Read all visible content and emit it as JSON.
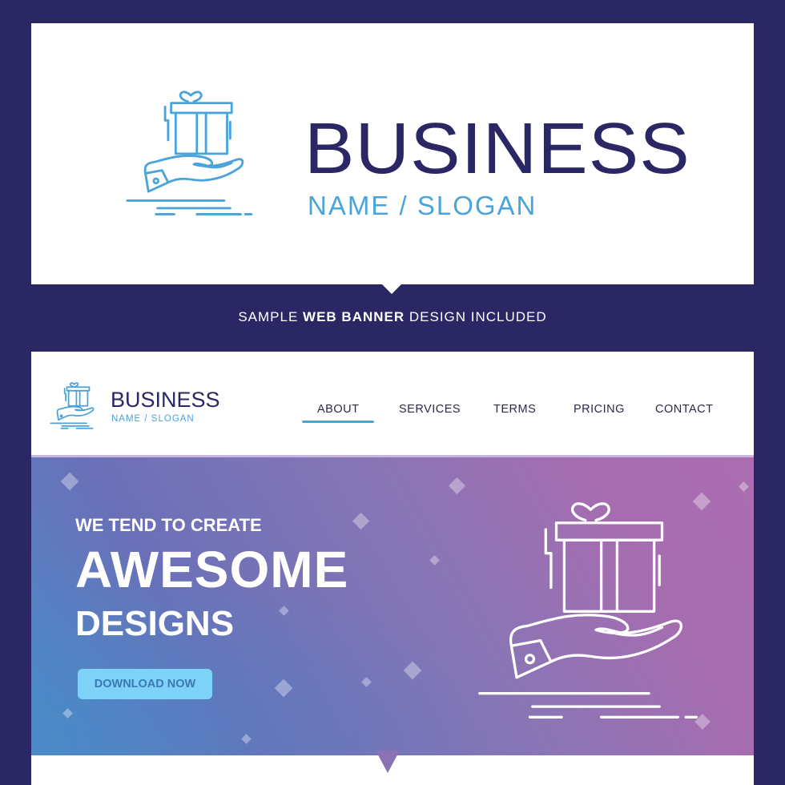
{
  "top_card": {
    "title": "BUSINESS",
    "slogan": "NAME / SLOGAN",
    "icon": "gift-on-hand-icon"
  },
  "caption": {
    "part1": "SAMPLE ",
    "bold": "WEB BANNER",
    "part2": " DESIGN INCLUDED"
  },
  "header": {
    "logo_title": "BUSINESS",
    "logo_slogan": "NAME / SLOGAN",
    "nav": [
      {
        "label": "ABOUT",
        "active": true
      },
      {
        "label": "SERVICES",
        "active": false
      },
      {
        "label": "TERMS",
        "active": false
      },
      {
        "label": "PRICING",
        "active": false
      },
      {
        "label": "CONTACT",
        "active": false
      }
    ]
  },
  "hero": {
    "subtitle": "WE TEND TO CREATE",
    "title_line1": "AWESOME",
    "title_line2": "DESIGNS",
    "cta_label": "DOWNLOAD NOW",
    "icon": "gift-on-hand-icon"
  },
  "colors": {
    "navy": "#2b2765",
    "accent_blue": "#4aa3d9",
    "cta_bg": "#7dd3f7",
    "cta_text": "#3b78b4"
  }
}
